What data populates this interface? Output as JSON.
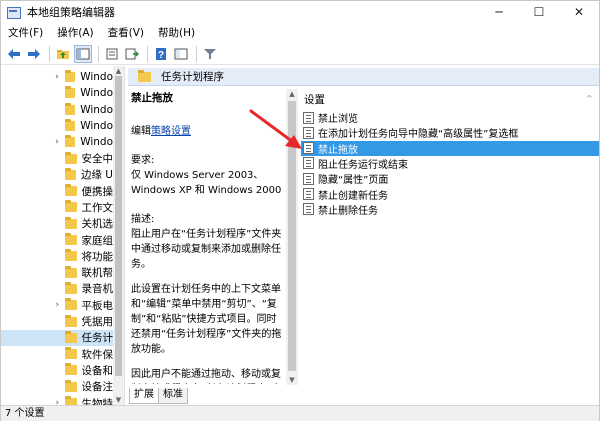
{
  "window": {
    "title": "本地组策略编辑器",
    "controls": [
      "─",
      "☐",
      "✕"
    ]
  },
  "menu": [
    "文件(F)",
    "操作(A)",
    "查看(V)",
    "帮助(H)"
  ],
  "toolbar": {
    "icons": [
      "back-arrow-icon",
      "forward-arrow-icon",
      "up-folder-icon",
      "show-hide-tree-icon",
      "properties-icon",
      "export-list-icon",
      "help-icon",
      "extended-view-icon",
      "filter-icon"
    ]
  },
  "tree": {
    "items": [
      {
        "label": "Windo",
        "expander": "›"
      },
      {
        "label": "Windo",
        "expander": ""
      },
      {
        "label": "Windo",
        "expander": ""
      },
      {
        "label": "Windo",
        "expander": ""
      },
      {
        "label": "Windo",
        "expander": "›"
      },
      {
        "label": "安全中",
        "expander": ""
      },
      {
        "label": "边缘 U",
        "expander": ""
      },
      {
        "label": "便携操",
        "expander": ""
      },
      {
        "label": "工作文",
        "expander": ""
      },
      {
        "label": "关机选",
        "expander": ""
      },
      {
        "label": "家庭组",
        "expander": ""
      },
      {
        "label": "将功能",
        "expander": ""
      },
      {
        "label": "联机帮",
        "expander": ""
      },
      {
        "label": "录音机",
        "expander": ""
      },
      {
        "label": "平板电",
        "expander": "›"
      },
      {
        "label": "凭据用",
        "expander": ""
      },
      {
        "label": "任务计",
        "expander": "",
        "selected": true
      },
      {
        "label": "软件保",
        "expander": ""
      },
      {
        "label": "设备和",
        "expander": ""
      },
      {
        "label": "设备注",
        "expander": ""
      },
      {
        "label": "生物特",
        "expander": "›"
      }
    ]
  },
  "panel": {
    "title": "任务计划程序"
  },
  "description": {
    "heading": "禁止拖放",
    "edit_prefix": "编辑",
    "edit_link": "策略设置",
    "requirements_label": "要求:",
    "requirements_text": "仅 Windows Server 2003、Windows XP 和 Windows 2000",
    "desc_label": "描述:",
    "para1": "阻止用户在“任务计划程序”文件夹中通过移动或复制来添加或删除任务。",
    "para2": "此设置在计划任务中的上下文菜单和“编辑”菜单中禁用“剪切”、“复制”和“粘贴”快捷方式项目。同时还禁用“任务计划程序”文件夹的拖放功能。",
    "para3": "因此用户不能通过拖动、移动或复制文档或程序向“任务计划程序”文件夹添加新的计划任务。"
  },
  "settings": {
    "header": "设置",
    "items": [
      {
        "label": "禁止浏览",
        "selected": false
      },
      {
        "label": "在添加计划任务向导中隐藏“高级属性”复选框",
        "selected": false
      },
      {
        "label": "禁止拖放",
        "selected": true
      },
      {
        "label": "阻止任务运行或结束",
        "selected": false
      },
      {
        "label": "隐藏“属性”页面",
        "selected": false
      },
      {
        "label": "禁止创建新任务",
        "selected": false
      },
      {
        "label": "禁止删除任务",
        "selected": false
      }
    ]
  },
  "tabs": [
    "扩展",
    "标准"
  ],
  "status": "7 个设置",
  "colors": {
    "selection": "#3399e6",
    "annotation_arrow": "#e8282b",
    "header_bg": "#e4ecf7"
  }
}
